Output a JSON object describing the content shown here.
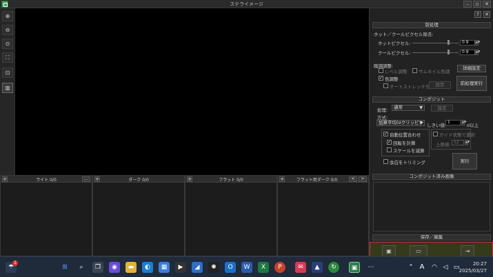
{
  "window": {
    "title": "ステライメージ",
    "controls": [
      "–",
      "▫",
      "✕"
    ]
  },
  "toolbar": {
    "buttons": [
      {
        "icon": "zoom-in-icon",
        "glyph": "⊕"
      },
      {
        "icon": "zoom-out-icon",
        "glyph": "⊖"
      },
      {
        "icon": "zoom-actual-icon",
        "glyph": "⊙"
      },
      {
        "icon": "fit-window-icon",
        "glyph": "⛶"
      },
      {
        "icon": "fit-selection-icon",
        "glyph": "⊡"
      },
      {
        "icon": "panel-layout-icon",
        "glyph": "▥"
      }
    ]
  },
  "frames": {
    "plus": "+",
    "more": "…",
    "prev": "<",
    "next": ">",
    "panels": [
      {
        "title": "ライト 0/0"
      },
      {
        "title": "ダーク 0/0"
      },
      {
        "title": "フラット 0/0"
      },
      {
        "title": "フラット用ダーク 0/0"
      }
    ]
  },
  "rightpanel": {
    "help": "?",
    "close": "✕",
    "preprocess": {
      "header": "前処理",
      "hotcool_label": "ホット／クールピクセル除去:",
      "hot_label": "ホットピクセル:",
      "hot_value": "0.9",
      "cool_label": "クールピクセル:",
      "cool_value": "0.9",
      "tone_label": "階調調整:",
      "level_label": "レベル調整",
      "thumb_label": "サムネイル色調",
      "color_label": "色調整",
      "autostretch_label": "オートストレッチを使う",
      "setting_btn": "設定",
      "detail_btn": "詳細設定",
      "run_btn": "前処理実行"
    },
    "composite": {
      "header": "コンポジット",
      "process_label": "処理:",
      "process_value": "通常",
      "process_setting_btn": "設定",
      "method_label": "方式:",
      "method_value": "加算平均(σクリッピング)",
      "threshold_label": "しきい値:",
      "threshold_value": "1",
      "threshold_unit": "σ以上",
      "autoalign_label": "自動位置合わせ",
      "rotation_label": "回転を計算",
      "scale_label": "スケールを減算",
      "guide_label": "ガイド状態で選択",
      "limit_label": "上限値:",
      "limit_value": "12",
      "trim_label": "余白をトリミング",
      "run_btn": "実行"
    },
    "stacked": {
      "header": "コンポジット済み画像"
    },
    "save": {
      "header": "保存／編集"
    }
  },
  "taskbar": {
    "notif_count": "1",
    "time": "20:27",
    "date": "2025/03/27",
    "ime": "A"
  },
  "colors": {
    "highlight_border": "#cc3333",
    "accent_green": "#3aa55a"
  }
}
